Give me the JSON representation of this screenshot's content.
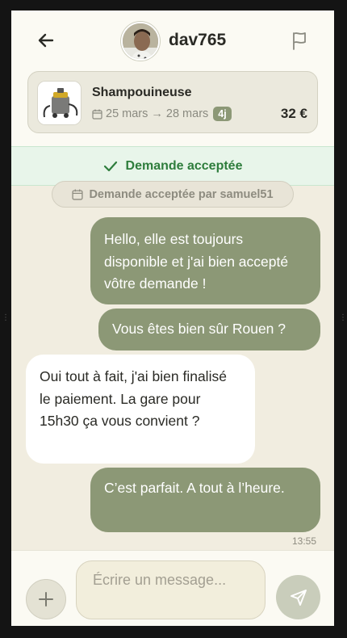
{
  "header": {
    "username": "dav765",
    "back_icon": "arrow-left-icon",
    "flag_icon": "flag-icon"
  },
  "item": {
    "title": "Shampouineuse",
    "date_start": "25 mars",
    "arrow": "→",
    "date_end": "28 mars",
    "duration": "4j",
    "price": "32 €"
  },
  "status_banner": "Demande acceptée",
  "system_message": "Demande acceptée par samuel51",
  "messages": [
    {
      "from": "me",
      "text": "Hello, elle est toujours disponible et j'ai bien accepté vôtre demande !"
    },
    {
      "from": "me",
      "text": "Vous êtes bien sûr Rouen ?"
    },
    {
      "from": "them",
      "text": "Oui tout à fait, j'ai bien finalisé le paiement. La gare pour 15h30 ça vous convient ?"
    },
    {
      "from": "me",
      "text": "C’est parfait. A tout à l’heure."
    }
  ],
  "last_timestamp": "13:55",
  "composer": {
    "placeholder": "Écrire un message...",
    "value": "",
    "add_icon": "plus-icon",
    "send_icon": "send-icon"
  },
  "colors": {
    "accent": "#8c9876",
    "success": "#2e7d3c",
    "background": "#f1ede0"
  }
}
